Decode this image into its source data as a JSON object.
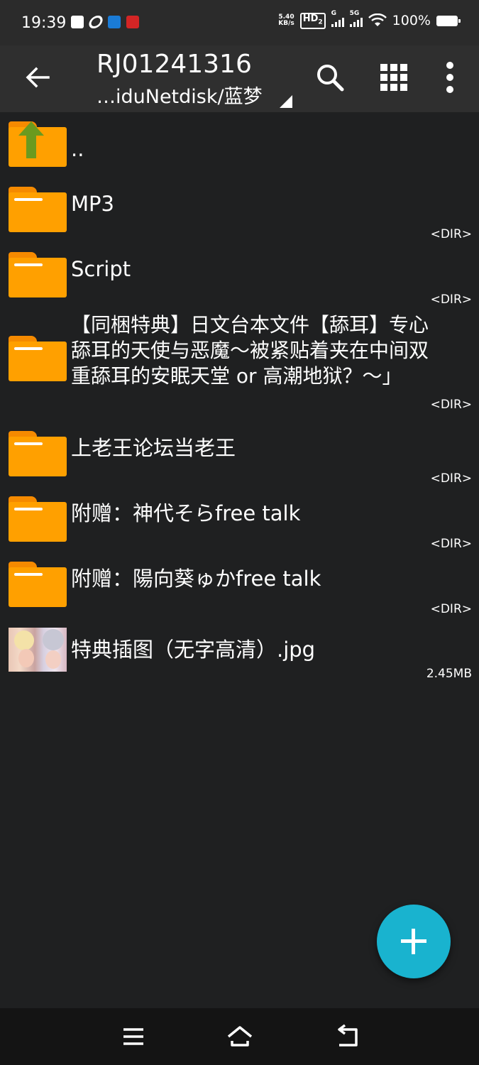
{
  "status_bar": {
    "time": "19:39",
    "net_speed_value": "5.40",
    "net_speed_unit": "KB/s",
    "hd_label": "HD",
    "hd_sub": "2",
    "sig1_label": "G",
    "sig2_label": "5G",
    "battery": "100%"
  },
  "toolbar": {
    "title": "RJ01241316",
    "subtitle": "…iduNetdisk/蓝梦"
  },
  "files": [
    {
      "name": "..",
      "type": "parent",
      "meta": ""
    },
    {
      "name": "MP3",
      "type": "folder",
      "meta": "<DIR>"
    },
    {
      "name": "Script",
      "type": "folder",
      "meta": "<DIR>"
    },
    {
      "name": "【同梱特典】日文台本文件【舔耳】专心舔耳的天使与恶魔～被紧贴着夹在中间双重舔耳的安眠天堂 or 高潮地狱？～」",
      "type": "folder",
      "meta": "<DIR>"
    },
    {
      "name": "上老王论坛当老王",
      "type": "folder",
      "meta": "<DIR>"
    },
    {
      "name": "附赠：神代そらfree talk",
      "type": "folder",
      "meta": "<DIR>"
    },
    {
      "name": "附赠：陽向葵ゅかfree talk",
      "type": "folder",
      "meta": "<DIR>"
    },
    {
      "name": "特典插图（无字高清）.jpg",
      "type": "image",
      "meta": "2.45MB"
    }
  ],
  "colors": {
    "background": "#1f2021",
    "toolbar": "#2f2f2f",
    "folder": "#ffa000",
    "fab": "#19b3cf",
    "up_arrow": "#6a9a1f"
  }
}
